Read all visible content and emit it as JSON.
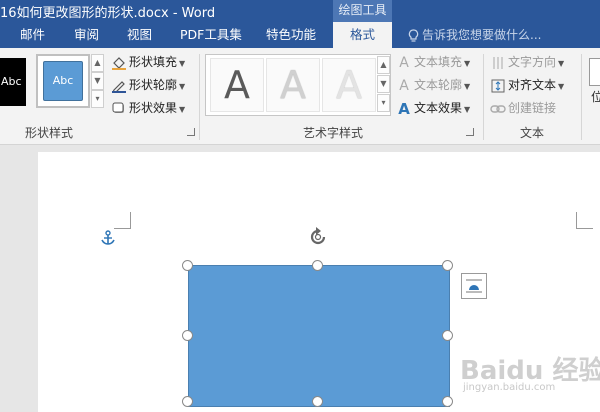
{
  "window": {
    "title": "16如何更改图形的形状.docx - Word",
    "context_tab_group": "绘图工具"
  },
  "tabs": [
    {
      "label": "邮件"
    },
    {
      "label": "审阅"
    },
    {
      "label": "视图"
    },
    {
      "label": "PDF工具集"
    },
    {
      "label": "特色功能"
    },
    {
      "label": "格式"
    }
  ],
  "tell_me": {
    "placeholder": "告诉我您想要做什么..."
  },
  "shape_styles": {
    "group_label": "形状样式",
    "swatch_text": "Abc",
    "fill": "形状填充",
    "outline": "形状轮廓",
    "effects": "形状效果"
  },
  "wordart_styles": {
    "group_label": "艺术字样式",
    "letter": "A",
    "text_fill": "文本填充",
    "text_outline": "文本轮廓",
    "text_effects": "文本效果"
  },
  "text_group": {
    "group_label": "文本",
    "direction": "文字方向",
    "align": "对齐文本",
    "link": "创建链接"
  },
  "partial": {
    "right_edge": "位"
  },
  "watermark": {
    "brand": "Baidu 经验",
    "url": "jingyan.baidu.com"
  },
  "colors": {
    "title_bar": "#2b579a",
    "shape_fill": "#5b9bd5",
    "accent": "#2b579a"
  }
}
